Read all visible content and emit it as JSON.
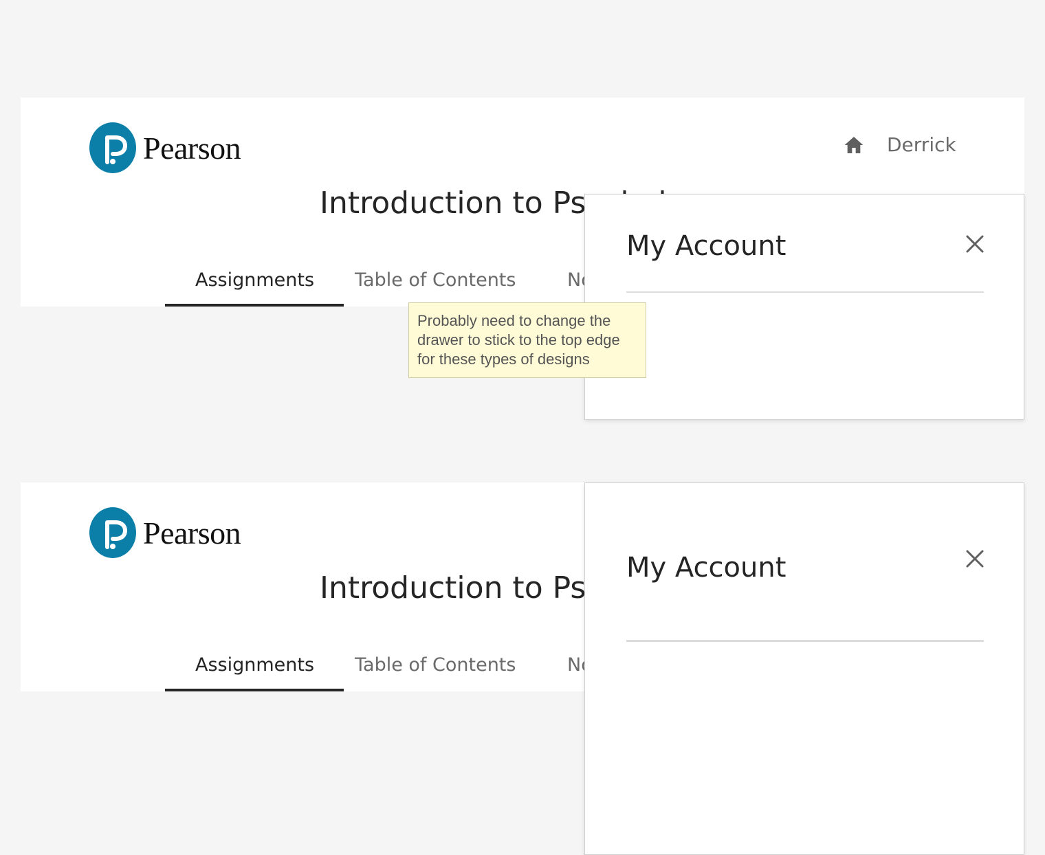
{
  "brand": {
    "name": "Pearson",
    "accent": "#0b7fa8"
  },
  "course": {
    "title": "Introduction to Psychology"
  },
  "tabs": [
    {
      "label": "Assignments",
      "active": true
    },
    {
      "label": "Table of Contents",
      "active": false
    },
    {
      "label": "Notes",
      "active": false
    }
  ],
  "header": {
    "home_icon": "home-icon",
    "user_name": "Derrick"
  },
  "drawer": {
    "title": "My Account",
    "close_icon": "close-icon"
  },
  "note": {
    "text": "Probably need to change the drawer to stick to the top edge for these types of designs"
  }
}
